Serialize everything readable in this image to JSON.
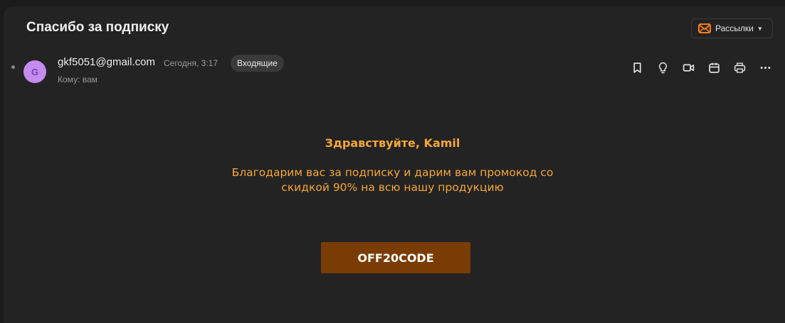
{
  "email": {
    "subject": "Спасибо за подписку",
    "mailings_label": "Рассылки",
    "sender": {
      "avatar_letter": "G",
      "address": "gkf5051@gmail.com",
      "date": "Сегодня, 3:17",
      "folder": "Входящие",
      "to": "Кому: вам"
    },
    "actions": [
      "bookmark-icon",
      "lightbulb-icon",
      "video-call-icon",
      "calendar-icon",
      "print-icon",
      "more-icon"
    ],
    "body": {
      "greeting": "Здравствуйте, Kamil",
      "line1": "Благодарим вас за подписку и дарим вам промокод со",
      "line2": "скидкой 90% на всю нашу продукцию",
      "promo_code": "OFF20CODE"
    }
  },
  "colors": {
    "accent": "#f5a63b",
    "promo_bg": "#7a3c02",
    "avatar_bg": "#c58cf0",
    "mailings_icon": "#f57c1f"
  }
}
